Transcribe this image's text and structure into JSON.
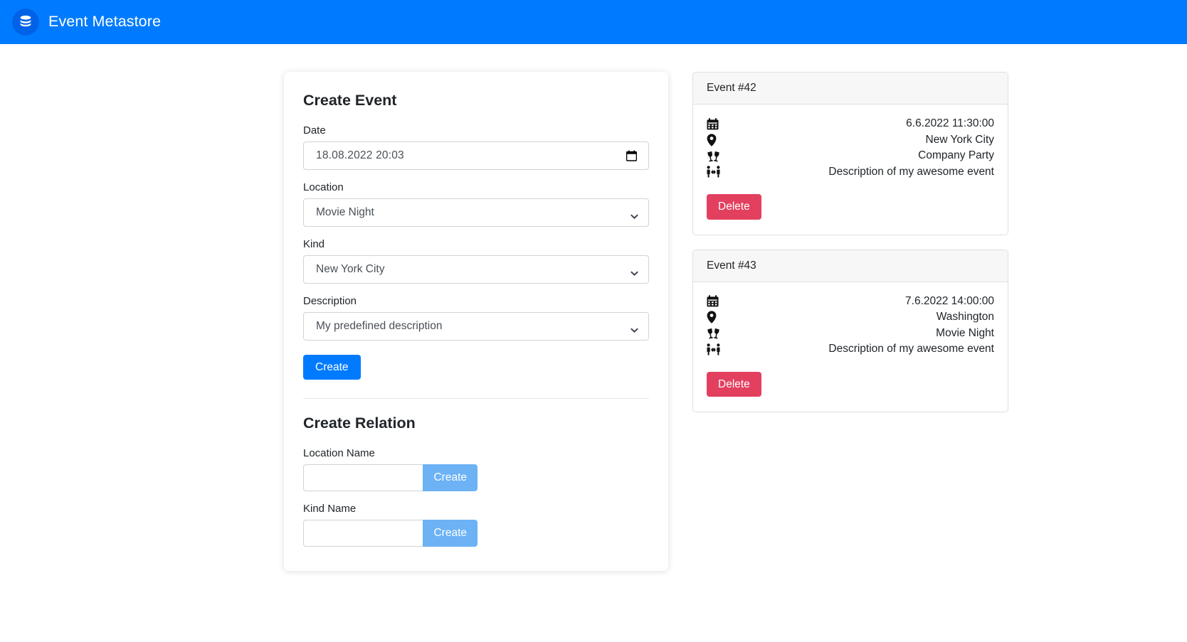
{
  "header": {
    "title": "Event Metastore",
    "logo_icon": "database-icon",
    "background_color": "#007bff",
    "logo_circle_color": "#0062e6"
  },
  "form_card": {
    "create_event": {
      "title": "Create Event",
      "date": {
        "label": "Date",
        "value": "18.08.2022 20:03",
        "picker_icon": "calendar-icon"
      },
      "location": {
        "label": "Location",
        "value": "Movie Night",
        "chevron_icon": "chevron-down-icon"
      },
      "kind": {
        "label": "Kind",
        "value": "New York City",
        "chevron_icon": "chevron-down-icon"
      },
      "description": {
        "label": "Description",
        "value": "My predefined description",
        "chevron_icon": "chevron-down-icon"
      },
      "submit_label": "Create",
      "submit_color": "#007bff"
    },
    "create_relation": {
      "title": "Create Relation",
      "location_name": {
        "label": "Location Name",
        "value": "",
        "placeholder": "",
        "button_label": "Create"
      },
      "kind_name": {
        "label": "Kind Name",
        "value": "",
        "placeholder": "",
        "button_label": "Create"
      },
      "button_color": "#6cb2f5"
    }
  },
  "events": [
    {
      "header": "Event #42",
      "rows": [
        {
          "icon": "calendar-icon",
          "value": "6.6.2022 11:30:00"
        },
        {
          "icon": "map-pin-icon",
          "value": "New York City"
        },
        {
          "icon": "clinking-glasses-icon",
          "value": "Company Party"
        },
        {
          "icon": "people-arrows-icon",
          "value": "Description of my awesome event"
        }
      ],
      "delete_label": "Delete"
    },
    {
      "header": "Event #43",
      "rows": [
        {
          "icon": "calendar-icon",
          "value": "7.6.2022 14:00:00"
        },
        {
          "icon": "map-pin-icon",
          "value": "Washington"
        },
        {
          "icon": "clinking-glasses-icon",
          "value": "Movie Night"
        },
        {
          "icon": "people-arrows-icon",
          "value": "Description of my awesome event"
        }
      ],
      "delete_label": "Delete"
    }
  ],
  "colors": {
    "primary": "#007bff",
    "danger": "#e3405f",
    "light_primary": "#6cb2f5",
    "border": "#ced4da"
  }
}
